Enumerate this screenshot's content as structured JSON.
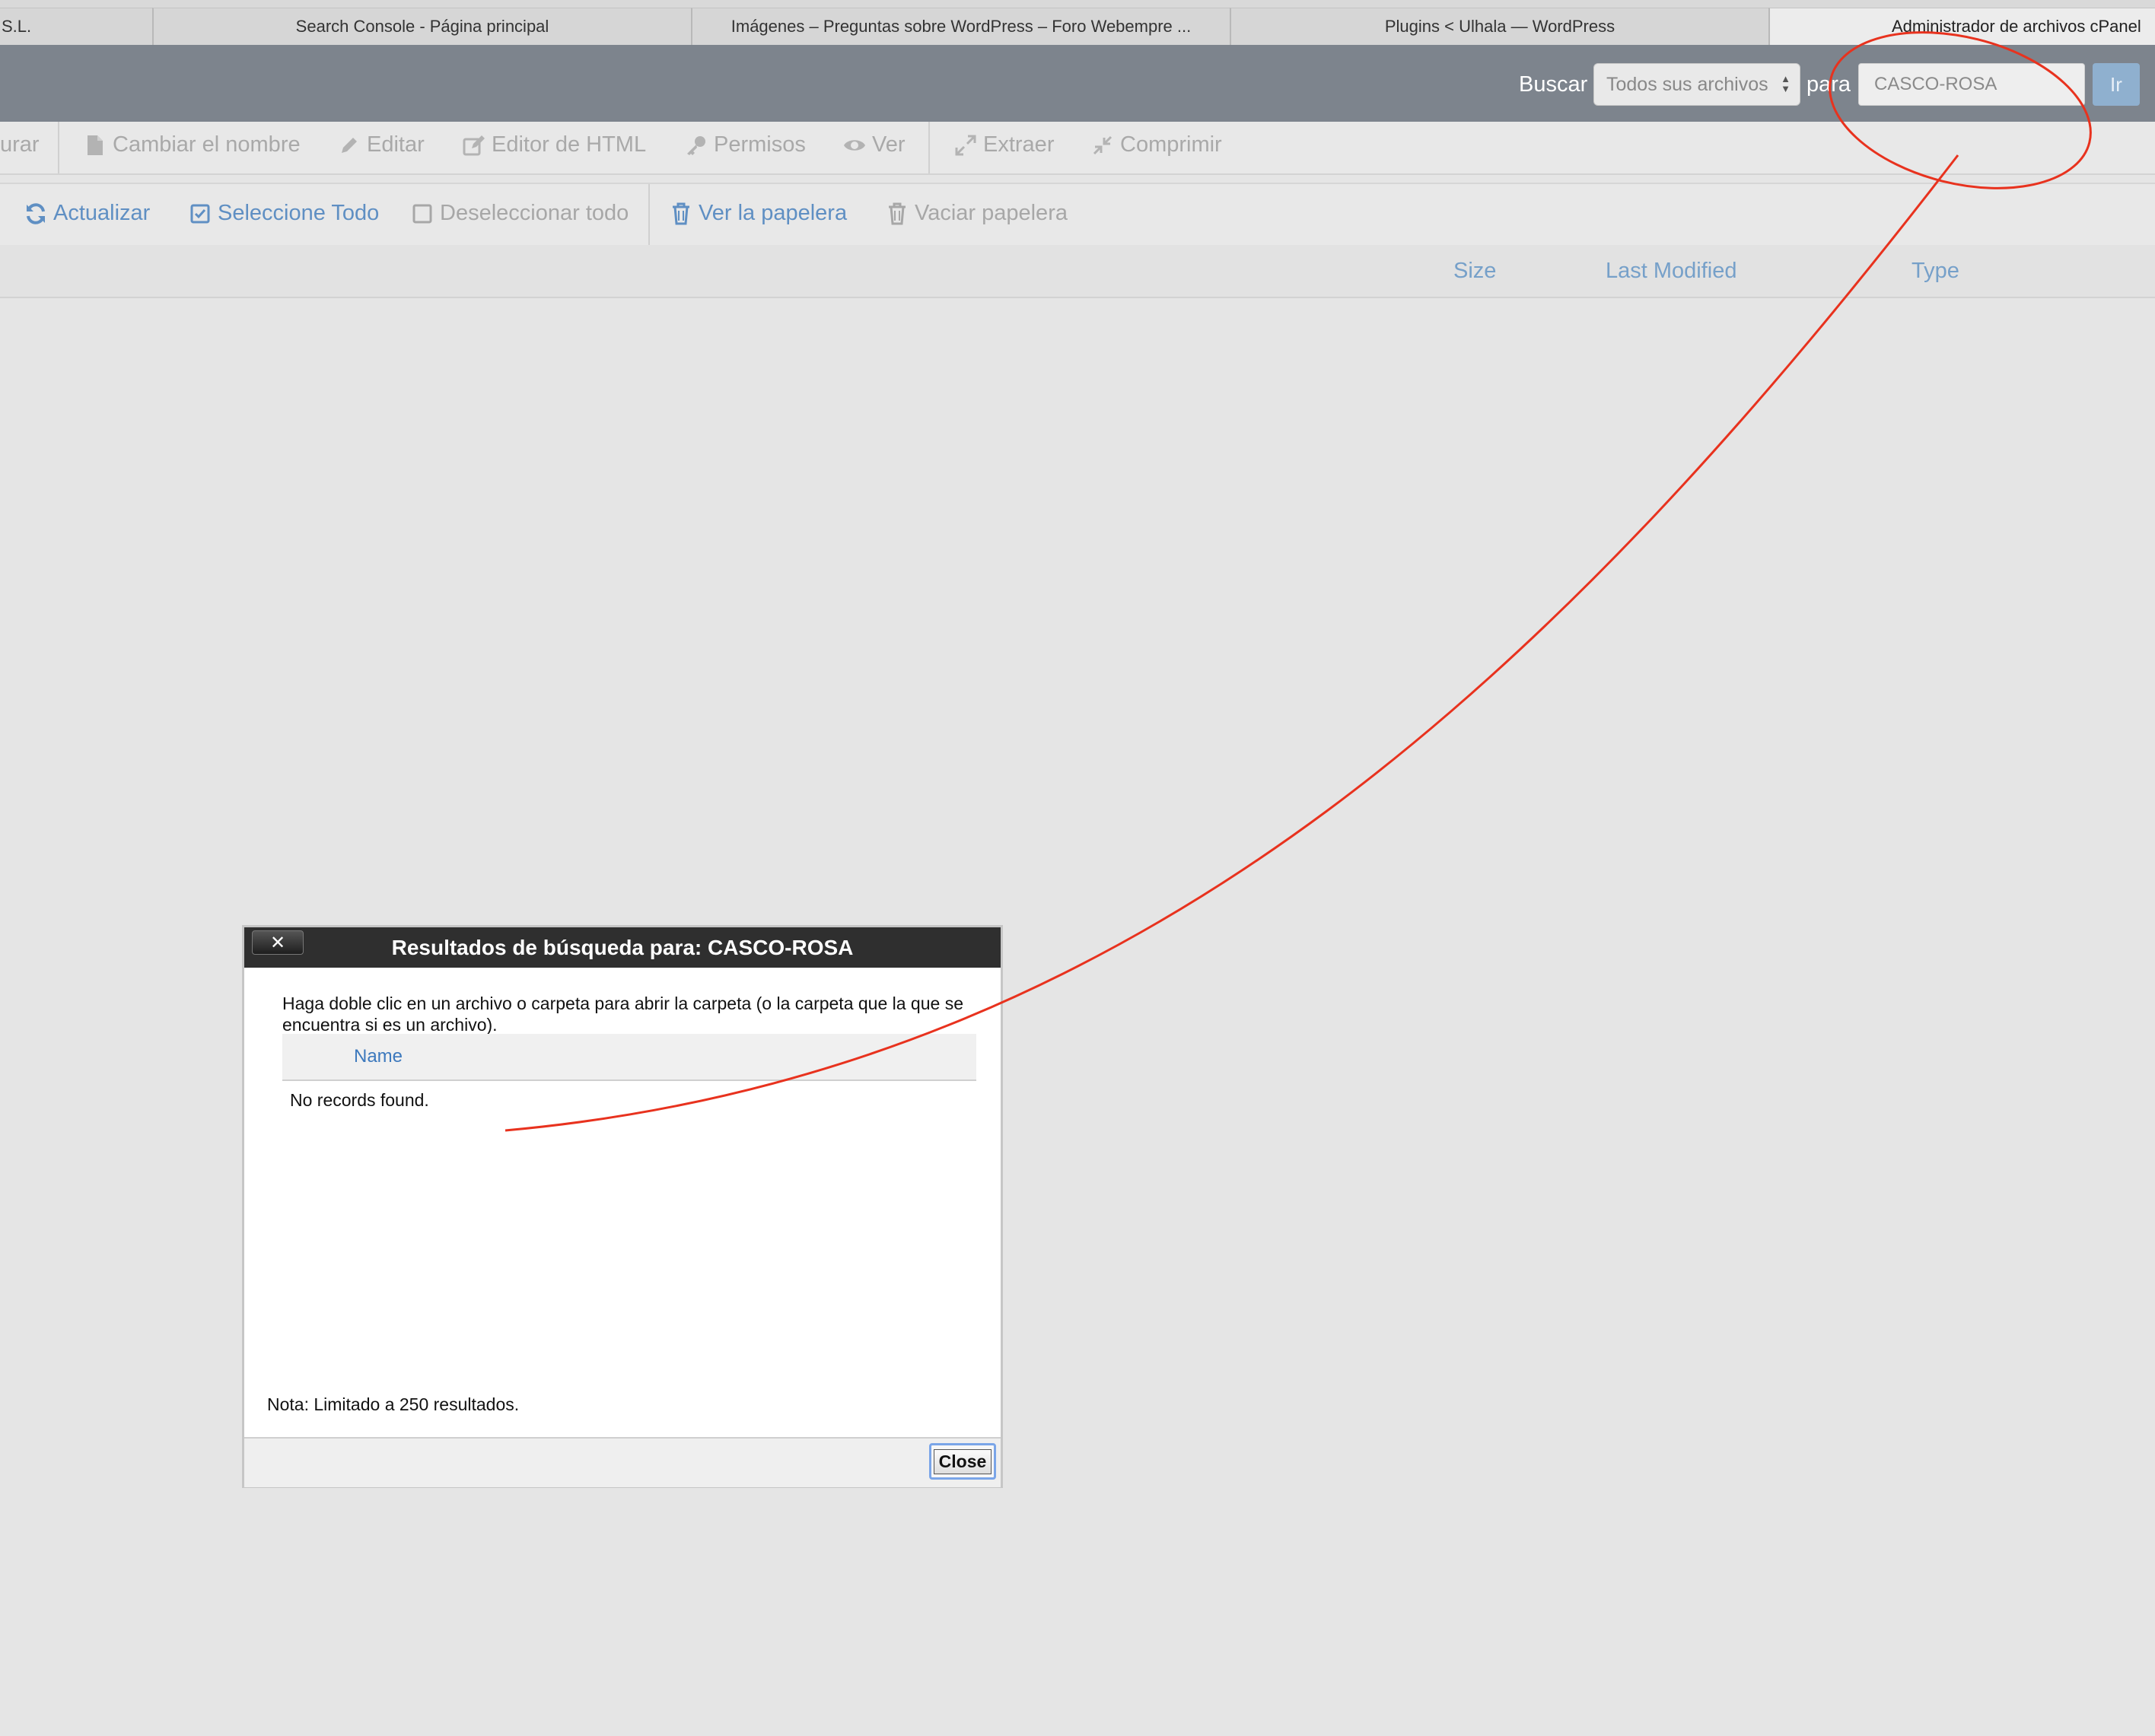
{
  "browser": {
    "tabs": [
      {
        "label": "S.L."
      },
      {
        "label": "Search Console - Página principal"
      },
      {
        "label": "Imágenes – Preguntas sobre WordPress – Foro Webempre ..."
      },
      {
        "label": "Plugins < Ulhala — WordPress"
      },
      {
        "label": "Administrador de archivos cPanel"
      }
    ]
  },
  "search": {
    "label": "Buscar",
    "scope": "Todos sus archivos",
    "for_label": "para",
    "query": "CASCO-ROSA",
    "go_label": "Ir"
  },
  "toolbar": {
    "items": [
      {
        "label": "urar",
        "icon": "partial-icon"
      },
      {
        "label": "Cambiar el nombre",
        "icon": "file-icon"
      },
      {
        "label": "Editar",
        "icon": "pencil-icon"
      },
      {
        "label": "Editor de HTML",
        "icon": "edit-icon"
      },
      {
        "label": "Permisos",
        "icon": "key-icon"
      },
      {
        "label": "Ver",
        "icon": "eye-icon"
      },
      {
        "label": "Extraer",
        "icon": "expand-icon"
      },
      {
        "label": "Comprimir",
        "icon": "compress-icon"
      }
    ]
  },
  "actions": {
    "items": [
      {
        "label": "Actualizar",
        "icon": "refresh-icon"
      },
      {
        "label": "Seleccione Todo",
        "icon": "checkbox-checked-icon"
      },
      {
        "label": "Deseleccionar todo",
        "icon": "checkbox-empty-icon"
      },
      {
        "label": "Ver la papelera",
        "icon": "trash-icon"
      },
      {
        "label": "Vaciar papelera",
        "icon": "trash-icon"
      }
    ]
  },
  "file_table": {
    "columns": [
      "Size",
      "Last Modified",
      "Type"
    ]
  },
  "dialog": {
    "title": "Resultados de búsqueda para: CASCO-ROSA",
    "close_x": "✕",
    "description": "Haga doble clic en un archivo o carpeta para abrir la carpeta (o la carpeta que la que se encuentra si es un archivo).",
    "column_name": "Name",
    "empty_message": "No records found.",
    "note": "Nota: Limitado a 250 resultados.",
    "close_label": "Close"
  },
  "colors": {
    "topbar": "#7d848d",
    "link": "#5f8fc3",
    "annotation": "#e8321e",
    "dialog_title": "#2f2f2f"
  }
}
